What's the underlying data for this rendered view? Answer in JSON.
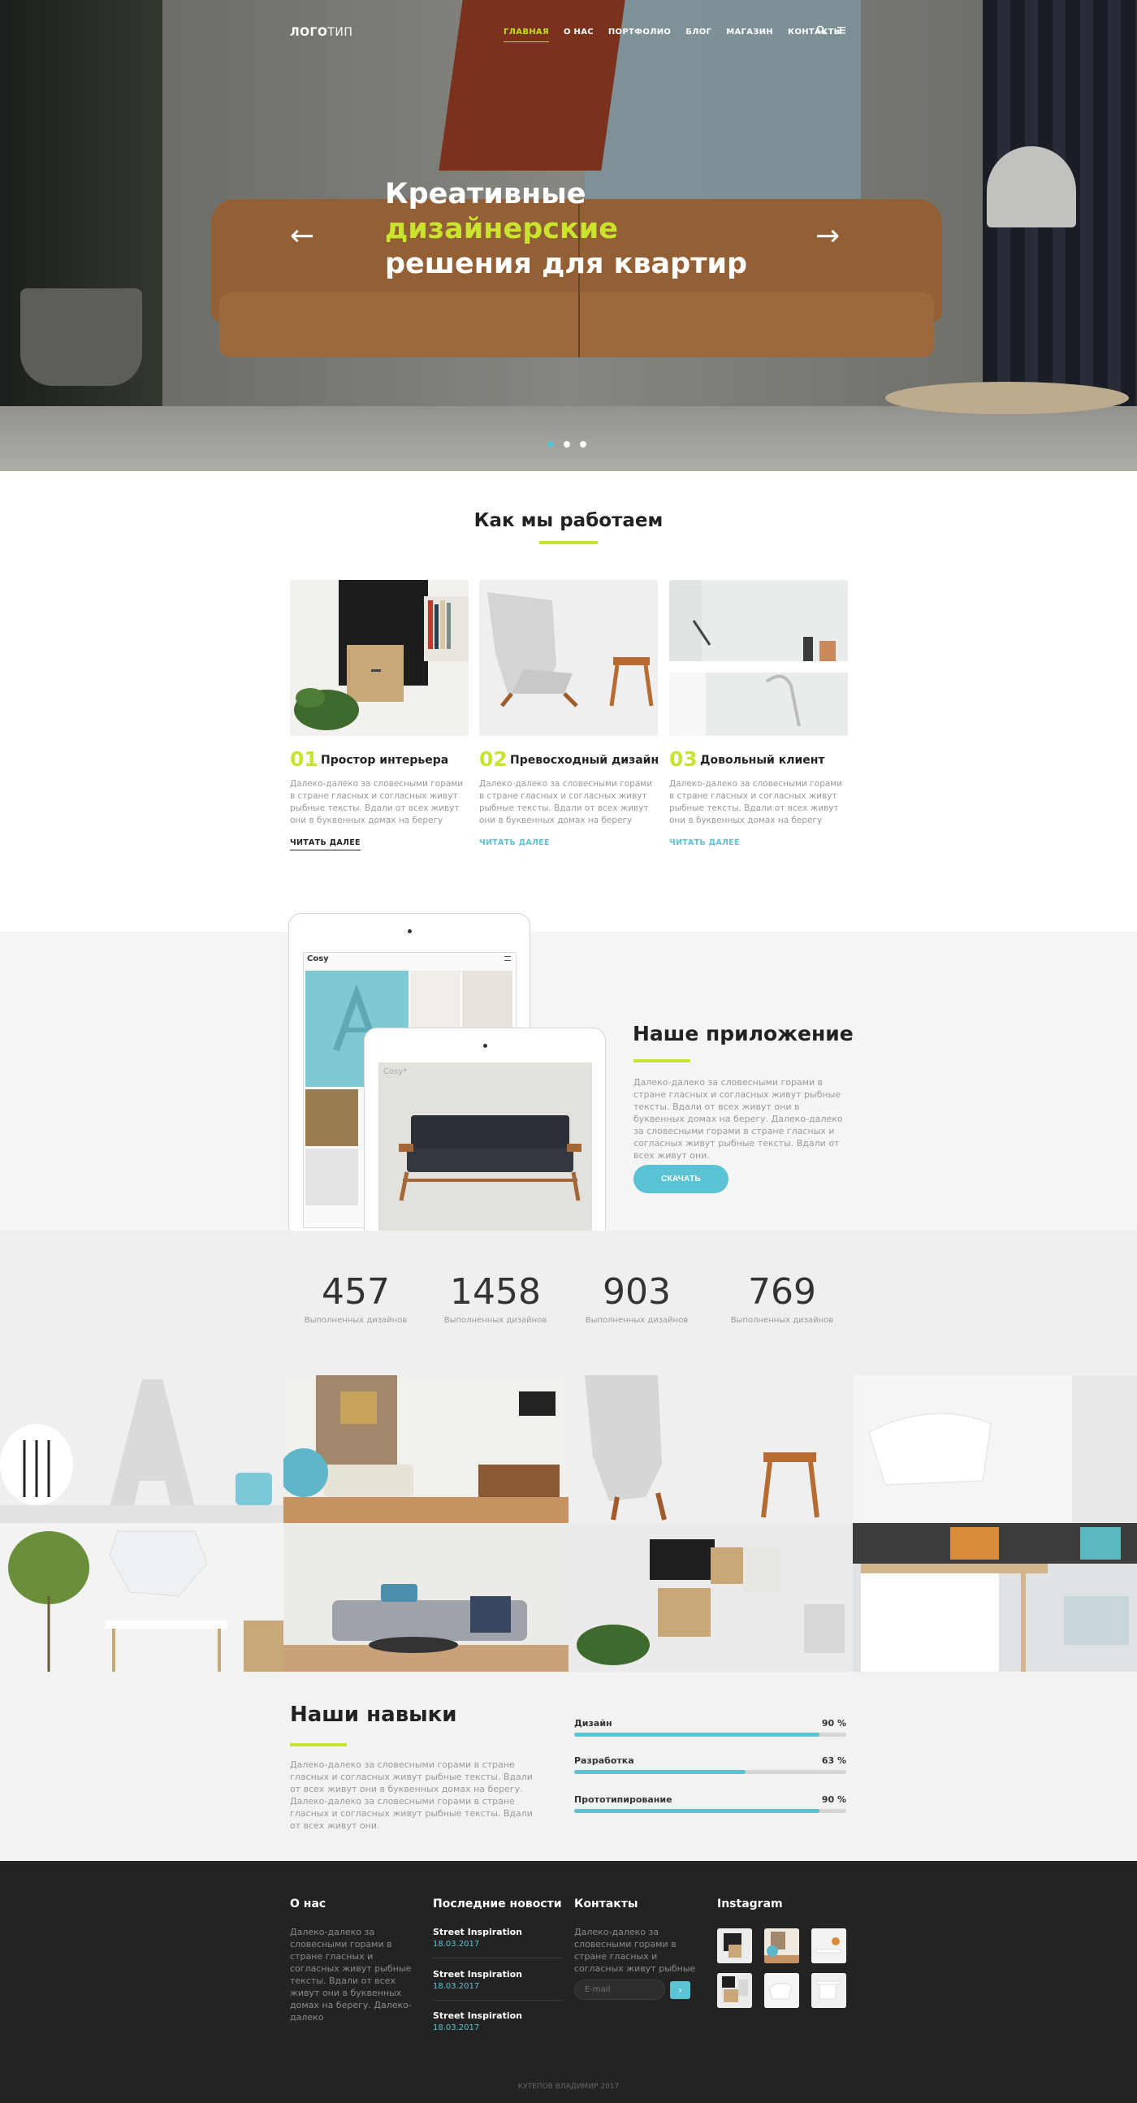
{
  "nav": {
    "logo_bold": "ЛОГО",
    "logo_rest": "ТИП",
    "items": [
      {
        "label": "ГЛАВНАЯ"
      },
      {
        "label": "О НАС"
      },
      {
        "label": "ПОРТФОЛИО"
      },
      {
        "label": "БЛОГ"
      },
      {
        "label": "МАГАЗИН"
      },
      {
        "label": "КОНТАКТЫ"
      }
    ],
    "icons": [
      "search-icon",
      "menu-icon"
    ]
  },
  "hero": {
    "line1": "Креативные",
    "line2": "дизайнерские",
    "line3": "решения для квартир",
    "prev": "←",
    "next": "→",
    "slides": 3,
    "active_slide": 1
  },
  "how": {
    "title": "Как мы работаем",
    "cards": [
      {
        "num": "01",
        "title": "Простор интерьера",
        "text": "Далеко-далеко за словесными горами в стране гласных и согласных живут рыбные тексты. Вдали от всех живут они в буквенных домах на берегу",
        "link": "ЧИТАТЬ ДАЛЕЕ"
      },
      {
        "num": "02",
        "title": "Превосходный дизайн",
        "text": "Далеко-далеко за словесными горами в стране гласных и согласных живут рыбные тексты. Вдали от всех живут они в буквенных домах на берегу",
        "link": "ЧИТАТЬ ДАЛЕЕ"
      },
      {
        "num": "03",
        "title": "Довольный клиент",
        "text": "Далеко-далеко за словесными горами в стране гласных и согласных живут рыбные тексты. Вдали от всех живут они в буквенных домах на берегу",
        "link": "ЧИТАТЬ ДАЛЕЕ"
      }
    ]
  },
  "app": {
    "title": "Наше приложение",
    "text": "Далеко-далеко за словесными горами в стране гласных и согласных живут рыбные тексты. Вдали от всех живут они в буквенных домах на берегу. Далеко-далеко за словесными горами в стране гласных и согласных живут рыбные тексты. Вдали от всех живут они.",
    "button": "СКАЧАТЬ",
    "screen_brand": "Cosy",
    "screen_brand2": "Cosy*"
  },
  "stats": [
    {
      "value": "457",
      "label": "Выполненных дизайнов"
    },
    {
      "value": "1458",
      "label": "Выполненных дизайнов"
    },
    {
      "value": "903",
      "label": "Выполненных дизайнов"
    },
    {
      "value": "769",
      "label": "Выполненных дизайнов"
    }
  ],
  "skills": {
    "title": "Наши навыки",
    "text": "Далеко-далеко за словесными горами в стране гласных и согласных живут рыбные тексты. Вдали от всех живут они в буквенных домах на берегу. Далеко-далеко за словесными горами в стране гласных и согласных живут рыбные тексты. Вдали от всех живут они.",
    "items": [
      {
        "name": "Дизайн",
        "value": "90 %",
        "level": 0.9
      },
      {
        "name": "Разработка",
        "value": "63 %",
        "level": 0.63
      },
      {
        "name": "Прототипирование",
        "value": "90 %",
        "level": 0.9
      }
    ]
  },
  "footer": {
    "about_title": "О нас",
    "about_text": "Далеко-далеко за словесными горами в стране гласных и согласных живут рыбные тексты. Вдали от всех живут они в буквенных домах на берегу. Далеко-далеко",
    "news_title": "Последние новости",
    "news": [
      {
        "title": "Street Inspiration",
        "date": "18.03.2017"
      },
      {
        "title": "Street Inspiration",
        "date": "18.03.2017"
      },
      {
        "title": "Street Inspiration",
        "date": "18.03.2017"
      }
    ],
    "contacts_title": "Контакты",
    "contacts_text": "Далеко-далеко за словесными горами в стране гласных и согласных живут рыбные",
    "email_placeholder": "E-mail",
    "email_button": "›",
    "instagram_title": "Instagram",
    "copyright": "КУТЕПОВ ВЛАДИМИР 2017"
  },
  "colors": {
    "accent_green": "#c9e32f",
    "accent_blue": "#5bc3d4",
    "footer_bg": "#232323"
  }
}
